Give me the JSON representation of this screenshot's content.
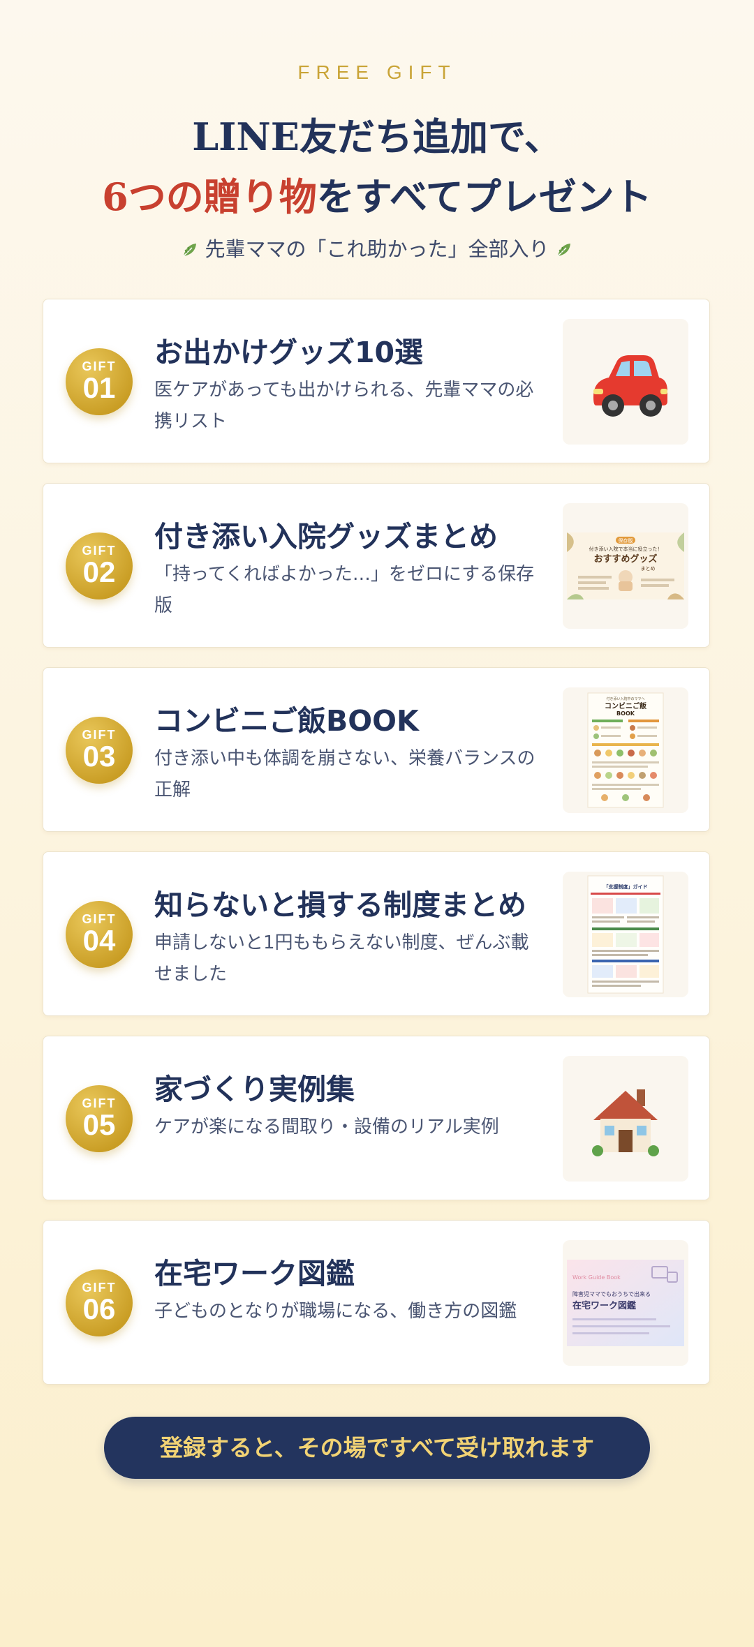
{
  "header": {
    "eyebrow": "FREE GIFT",
    "headline_line1": "LINE友だち追加で、",
    "headline_accent": "6つの贈り物",
    "headline_rest": "をすべてプレゼント",
    "subline": "先輩ママの「これ助かった」全部入り",
    "leaf_icon": "leaf-icon"
  },
  "colors": {
    "navy": "#22325a",
    "gold": "#c9a437",
    "accent_red": "#c8402f",
    "cta_bg": "#23345e",
    "cta_text": "#f2d374"
  },
  "gifts": [
    {
      "badge_label": "GIFT",
      "number": "01",
      "title": "お出かけグッズ10選",
      "description": "医ケアがあっても出かけられる、先輩ママの必携リスト",
      "thumb": "car-icon"
    },
    {
      "badge_label": "GIFT",
      "number": "02",
      "title": "付き添い入院グッズまとめ",
      "description": "「持ってくればよかった…」をゼロにする保存版",
      "thumb": "hospital-goods-booklet",
      "thumb_tag": "保存版",
      "thumb_title_top": "付き添い入院で本当に役立った！",
      "thumb_title_main": "おすすめグッズ",
      "thumb_title_sub": "まとめ"
    },
    {
      "badge_label": "GIFT",
      "number": "03",
      "title": "コンビニご飯BOOK",
      "description": "付き添い中も体調を崩さない、栄養バランスの正解",
      "thumb": "convenience-food-booklet",
      "thumb_title_top": "付き添い入院中のママへ",
      "thumb_title_main": "コンビニご飯",
      "thumb_title_sub": "BOOK"
    },
    {
      "badge_label": "GIFT",
      "number": "04",
      "title": "知らないと損する制度まとめ",
      "description": "申請しないと1円ももらえない制度、ぜんぶ載せました",
      "thumb": "support-system-sheet",
      "thumb_title_main": "「支援制度」ガイド"
    },
    {
      "badge_label": "GIFT",
      "number": "05",
      "title": "家づくり実例集",
      "description": "ケアが楽になる間取り・設備のリアル実例",
      "thumb": "house-icon"
    },
    {
      "badge_label": "GIFT",
      "number": "06",
      "title": "在宅ワーク図鑑",
      "description": "子どものとなりが職場になる、働き方の図鑑",
      "thumb": "remote-work-booklet",
      "thumb_eyebrow": "Work Guide Book",
      "thumb_line1": "障害児ママでもおうちで出来る",
      "thumb_title_main": "在宅ワーク図鑑"
    }
  ],
  "cta": {
    "label": "登録すると、その場ですべて受け取れます"
  }
}
